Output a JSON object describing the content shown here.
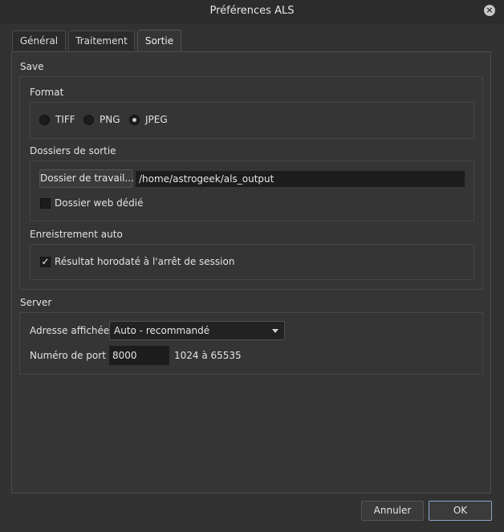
{
  "window": {
    "title": "Préférences ALS"
  },
  "tabs": [
    {
      "label": "Général"
    },
    {
      "label": "Traitement"
    },
    {
      "label": "Sortie"
    }
  ],
  "save": {
    "title": "Save",
    "format": {
      "title": "Format",
      "options": [
        "TIFF",
        "PNG",
        "JPEG"
      ],
      "selected": "JPEG"
    },
    "output_folders": {
      "title": "Dossiers de sortie",
      "work_folder_button": "Dossier de travail...",
      "work_folder_path": "/home/astrogeek/als_output",
      "web_folder_label": "Dossier web dédié",
      "web_folder_checked": false
    },
    "auto_save": {
      "title": "Enreistrement auto",
      "timestamped_label": "Résultat horodaté à l'arrêt de session",
      "timestamped_checked": true,
      "check_mark": "✓"
    }
  },
  "server": {
    "title": "Server",
    "address_label": "Adresse affichée",
    "address_value": "Auto - recommandé",
    "port_label": "Numéro de port",
    "port_value": "8000",
    "port_range": "1024 à 65535"
  },
  "footer": {
    "cancel_label": "Annuler",
    "ok_label": "OK"
  },
  "icons": {
    "close": "close-icon",
    "dropdown": "chevron-down-icon"
  },
  "colors": {
    "background": "#323232",
    "accent_border": "#8aa6c9"
  }
}
